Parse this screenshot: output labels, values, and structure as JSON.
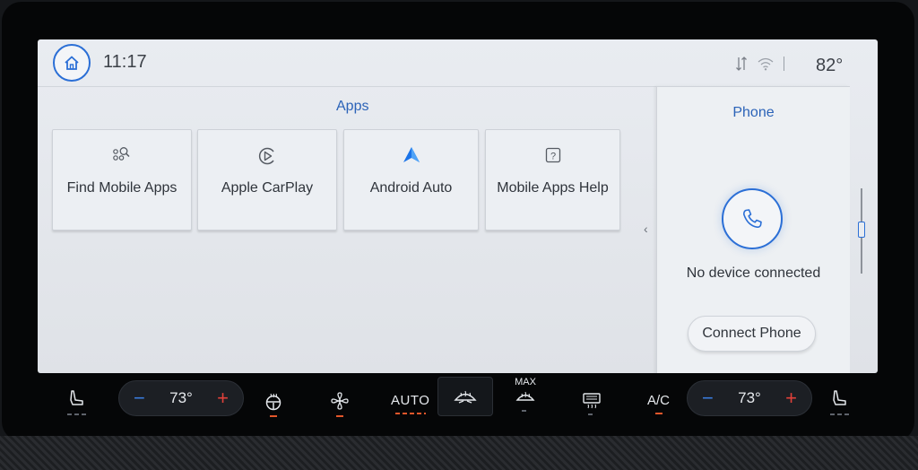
{
  "status_bar": {
    "time": "11:17",
    "outside_temp": "82°"
  },
  "apps": {
    "title": "Apps",
    "tiles": [
      {
        "label": "Find Mobile Apps",
        "icon": "find-apps-icon"
      },
      {
        "label": "Apple CarPlay",
        "icon": "carplay-icon"
      },
      {
        "label": "Android Auto",
        "icon": "android-auto-icon"
      },
      {
        "label": "Mobile Apps Help",
        "icon": "help-icon"
      }
    ]
  },
  "phone": {
    "title": "Phone",
    "status": "No device connected",
    "connect_label": "Connect Phone"
  },
  "climate": {
    "driver_temp": "73°",
    "passenger_temp": "73°",
    "minus_label": "−",
    "plus_label": "+",
    "auto_label": "AUTO",
    "max_label": "MAX",
    "ac_label": "A/C"
  },
  "colors": {
    "accent_blue": "#2b6fd6",
    "indicator_orange": "#e2562a",
    "plus_red": "#e2413a",
    "minus_blue": "#3b7de0"
  }
}
